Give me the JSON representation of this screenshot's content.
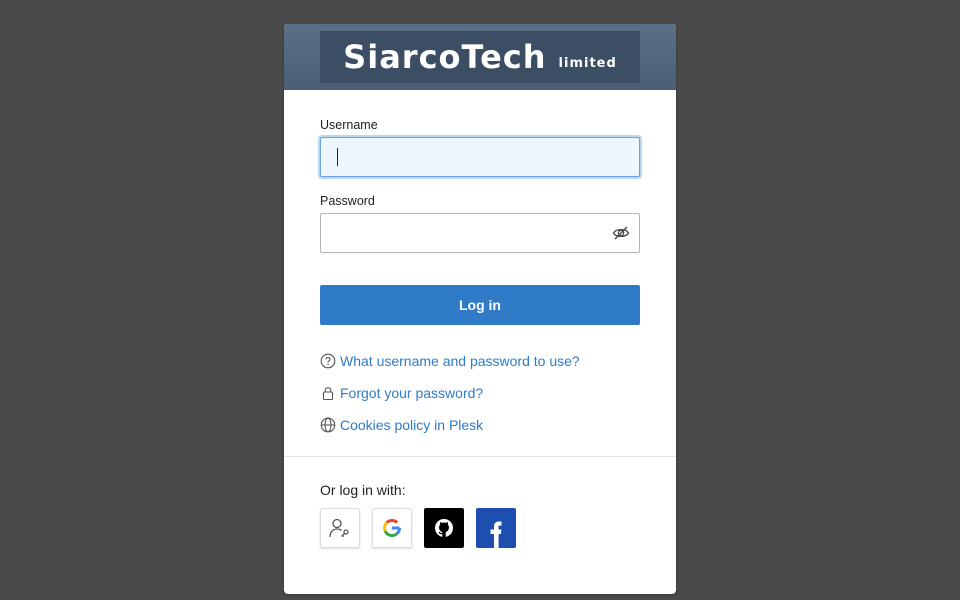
{
  "header": {
    "logo_main": "SiarcoTech",
    "logo_sub": "limited"
  },
  "form": {
    "username_label": "Username",
    "username_value": "",
    "password_label": "Password",
    "password_value": "",
    "login_label": "Log in"
  },
  "links": [
    {
      "icon": "question-circle-icon",
      "label": "What username and password to use?"
    },
    {
      "icon": "lock-icon",
      "label": "Forgot your password?"
    },
    {
      "icon": "globe-icon",
      "label": "Cookies policy in Plesk"
    }
  ],
  "social": {
    "label": "Or log in with:",
    "providers": [
      {
        "icon": "user-key-icon"
      },
      {
        "icon": "google-icon"
      },
      {
        "icon": "github-icon"
      },
      {
        "icon": "facebook-icon"
      }
    ]
  },
  "colors": {
    "accent": "#2f7bc8",
    "background": "#4a4a4a",
    "header": "#53677e",
    "facebook": "#1c4fb0"
  }
}
